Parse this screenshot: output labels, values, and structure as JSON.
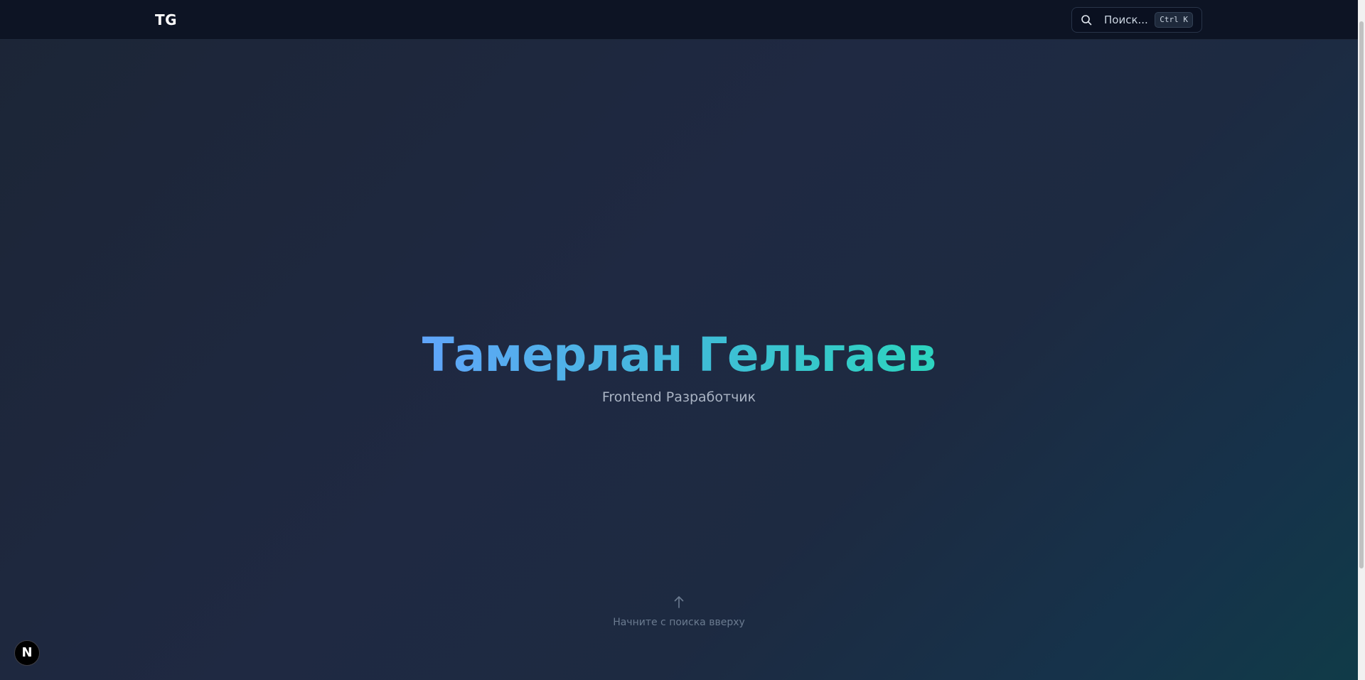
{
  "header": {
    "logo": "TG",
    "search": {
      "placeholder": "Поиск...",
      "shortcut": "Ctrl K",
      "icon": "search-icon"
    }
  },
  "hero": {
    "title": "Тамерлан Гельгаев",
    "subtitle": "Frontend Разработчик"
  },
  "scroll_hint": {
    "icon": "arrow-up-icon",
    "text": "Начните с поиска вверху"
  },
  "badge": {
    "label": "N",
    "icon": "nextjs-icon"
  },
  "colors": {
    "header_bg": "#0d1424",
    "gradient_start": "#60a5fa",
    "gradient_end": "#2dd4bf",
    "subtitle": "#aab4c4"
  }
}
